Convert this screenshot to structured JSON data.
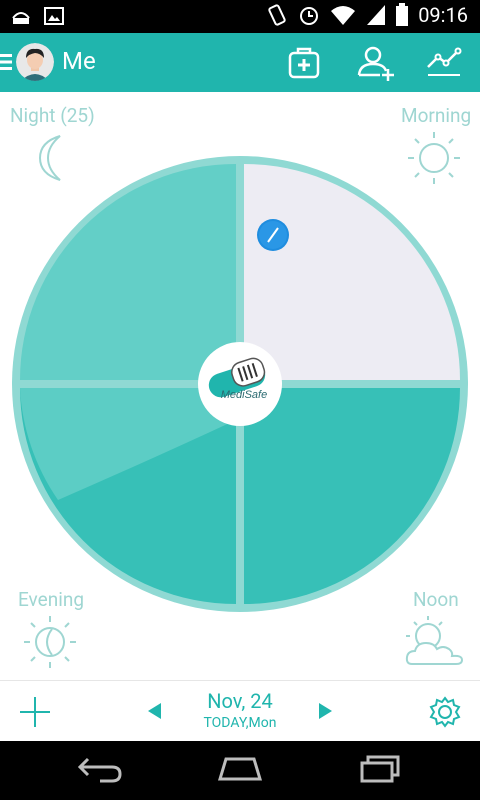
{
  "status": {
    "time": "09:16"
  },
  "appbar": {
    "title": "Me"
  },
  "dial": {
    "night_label": "Night (25)",
    "morning_label": "Morning",
    "evening_label": "Evening",
    "noon_label": "Noon",
    "brand": "MediSafe"
  },
  "footer": {
    "date": "Nov, 24",
    "subtitle": "TODAY,Mon"
  },
  "colors": {
    "teal": "#20b5ad",
    "light_teal": "#5fcfc8",
    "ring": "#8fd9d3",
    "selected_quadrant": "#edecf3",
    "pill": "#1f8ddf"
  }
}
